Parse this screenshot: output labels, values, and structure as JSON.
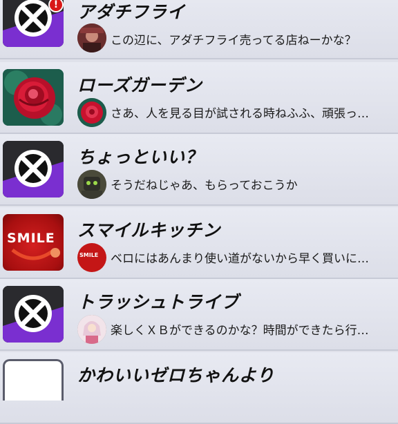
{
  "conversations": [
    {
      "name": "アダチフライ",
      "message": "この辺に、アダチフライ売ってる店ねーかな？",
      "icon": "xb-logo-icon",
      "avatar": "character-avatar",
      "badge": "!"
    },
    {
      "name": "ローズガーデン",
      "message": "さあ、人を見る目が試される時ねふふ、頑張っ…",
      "icon": "rose-icon",
      "avatar": "rose-avatar"
    },
    {
      "name": "ちょっといい？",
      "message": "そうだねじゃあ、もらっておこうか",
      "icon": "xb-logo-icon",
      "avatar": "robot-avatar"
    },
    {
      "name": "スマイルキッチン",
      "message": "ベロにはあんまり使い道がないから早く買いに…",
      "icon": "smile-logo-icon",
      "icon_text": "SMILE",
      "avatar": "smile-avatar",
      "avatar_text": "SMILE"
    },
    {
      "name": "トラッシュトライブ",
      "message": "楽しくＸＢができるのかな？時間ができたら行…",
      "icon": "xb-logo-icon",
      "avatar": "girl-avatar"
    },
    {
      "name": "かわいいゼロちゃんより",
      "icon": "blank-icon"
    }
  ],
  "colors": {
    "background": "#dfe1ea",
    "xb_purple": "#7a2fd0",
    "badge_red": "#d81818",
    "smile_red": "#c41616"
  }
}
